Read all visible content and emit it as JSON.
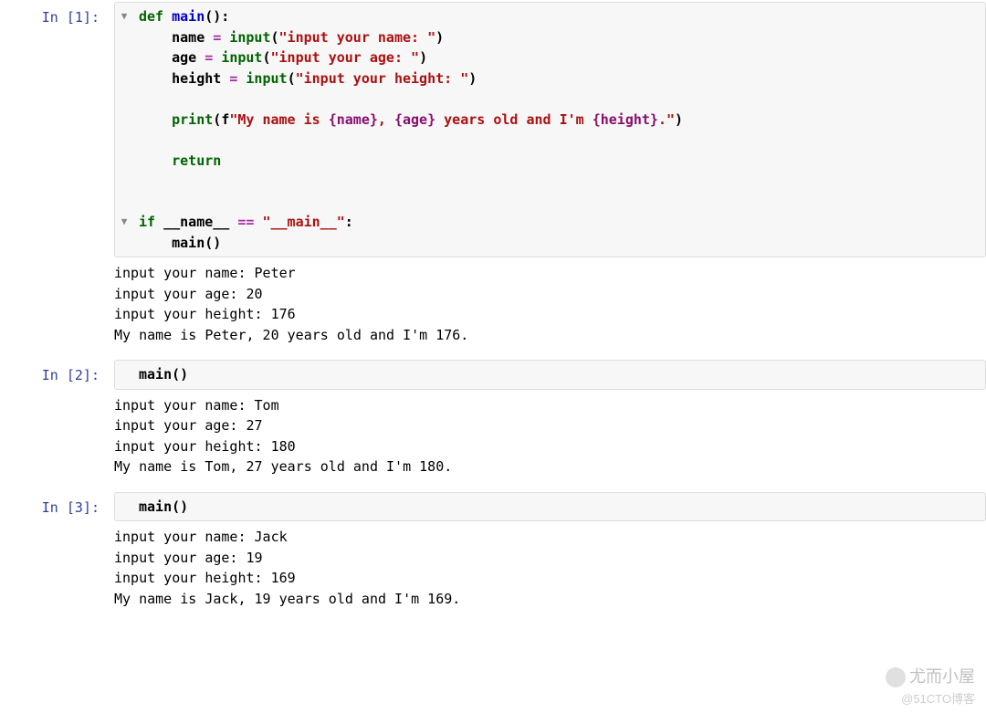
{
  "cells": [
    {
      "prompt": "In [1]:",
      "code_tokens": [
        [
          [
            "kw",
            "def"
          ],
          [
            "nm",
            " "
          ],
          [
            "fn",
            "main"
          ],
          [
            "pr",
            "():"
          ]
        ],
        [
          [
            "nm",
            "    name "
          ],
          [
            "op",
            "="
          ],
          [
            "nm",
            " "
          ],
          [
            "bi",
            "input"
          ],
          [
            "pr",
            "("
          ],
          [
            "str",
            "\"input your name: \""
          ],
          [
            "pr",
            ")"
          ]
        ],
        [
          [
            "nm",
            "    age "
          ],
          [
            "op",
            "="
          ],
          [
            "nm",
            " "
          ],
          [
            "bi",
            "input"
          ],
          [
            "pr",
            "("
          ],
          [
            "str",
            "\"input your age: \""
          ],
          [
            "pr",
            ")"
          ]
        ],
        [
          [
            "nm",
            "    height "
          ],
          [
            "op",
            "="
          ],
          [
            "nm",
            " "
          ],
          [
            "bi",
            "input"
          ],
          [
            "pr",
            "("
          ],
          [
            "str",
            "\"input your height: \""
          ],
          [
            "pr",
            ")"
          ]
        ],
        [
          [
            "nm",
            " "
          ]
        ],
        [
          [
            "nm",
            "    "
          ],
          [
            "bi",
            "print"
          ],
          [
            "pr",
            "("
          ],
          [
            "nm",
            "f"
          ],
          [
            "str",
            "\"My name is "
          ],
          [
            "fstr",
            "{name}"
          ],
          [
            "str",
            ", "
          ],
          [
            "fstr",
            "{age}"
          ],
          [
            "str",
            " years old and I'm "
          ],
          [
            "fstr",
            "{height}"
          ],
          [
            "str",
            ".\""
          ],
          [
            "pr",
            ")"
          ]
        ],
        [
          [
            "nm",
            " "
          ]
        ],
        [
          [
            "nm",
            "    "
          ],
          [
            "kw",
            "return"
          ]
        ],
        [
          [
            "nm",
            " "
          ]
        ],
        [
          [
            "nm",
            " "
          ]
        ],
        [
          [
            "kw",
            "if"
          ],
          [
            "nm",
            " __name__ "
          ],
          [
            "op",
            "=="
          ],
          [
            "nm",
            " "
          ],
          [
            "str",
            "\"__main__\""
          ],
          [
            "pr",
            ":"
          ]
        ],
        [
          [
            "nm",
            "    main"
          ],
          [
            "pr",
            "()"
          ]
        ]
      ],
      "folds": [
        0,
        10
      ],
      "output": "input your name: Peter\ninput your age: 20\ninput your height: 176\nMy name is Peter, 20 years old and I'm 176."
    },
    {
      "prompt": "In [2]:",
      "code_tokens": [
        [
          [
            "nm",
            "main"
          ],
          [
            "pr",
            "()"
          ]
        ]
      ],
      "folds": [],
      "output": "input your name: Tom\ninput your age: 27\ninput your height: 180\nMy name is Tom, 27 years old and I'm 180."
    },
    {
      "prompt": "In [3]:",
      "code_tokens": [
        [
          [
            "nm",
            "main"
          ],
          [
            "pr",
            "()"
          ]
        ]
      ],
      "folds": [],
      "output": "input your name: Jack\ninput your age: 19\ninput your height: 169\nMy name is Jack, 19 years old and I'm 169."
    }
  ],
  "watermark": {
    "text": "尤而小屋",
    "sub": "@51CTO博客"
  }
}
